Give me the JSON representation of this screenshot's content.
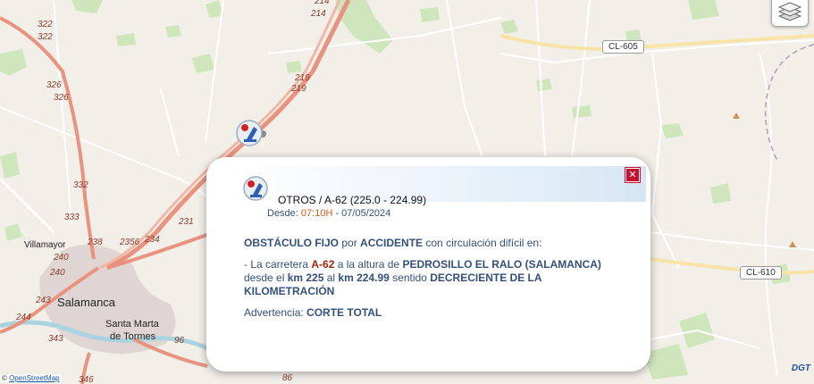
{
  "map": {
    "place_labels": [
      {
        "text": "Villamayor",
        "size": 10
      },
      {
        "text": "Salamanca",
        "size": 13
      },
      {
        "text": "Santa Marta",
        "size": 11
      },
      {
        "text": "de Tormes",
        "size": 11
      }
    ],
    "road_numbers": [
      "322",
      "322",
      "326",
      "326",
      "332",
      "333",
      "240",
      "240",
      "243",
      "244",
      "343",
      "346",
      "238",
      "2356",
      "234",
      "231",
      "219",
      "219",
      "214",
      "214",
      "96",
      "86"
    ],
    "shields": {
      "cl605": "CL-605",
      "cl610": "CL-610"
    },
    "attribution_prefix": "© ",
    "attribution_link": "OpenStreetMap",
    "logo": "DGT"
  },
  "popup": {
    "title": "OTROS / A-62 (225.0 - 224.99)",
    "date_prefix": "Desde: ",
    "time": "07:10H",
    "date": " - 07/05/2024",
    "line1_a": "OBSTÁCULO FIJO",
    "line1_b": " por ",
    "line1_c": "ACCIDENTE",
    "line1_d": " con circulación difícil en:",
    "detail_a": "- La carretera ",
    "detail_road": "A-62",
    "detail_b": " a la altura de ",
    "detail_place": "PEDROSILLO EL RALO (SALAMANCA)",
    "detail_c": " desde el ",
    "detail_km1": "km 225",
    "detail_d": " al ",
    "detail_km2": "km 224.99",
    "detail_e": " sentido ",
    "detail_dir": "DECRECIENTE DE LA KILOMETRACIÓN",
    "warning_label": "Advertencia: ",
    "warning_value": "CORTE TOTAL",
    "close_symbol": "✕"
  }
}
